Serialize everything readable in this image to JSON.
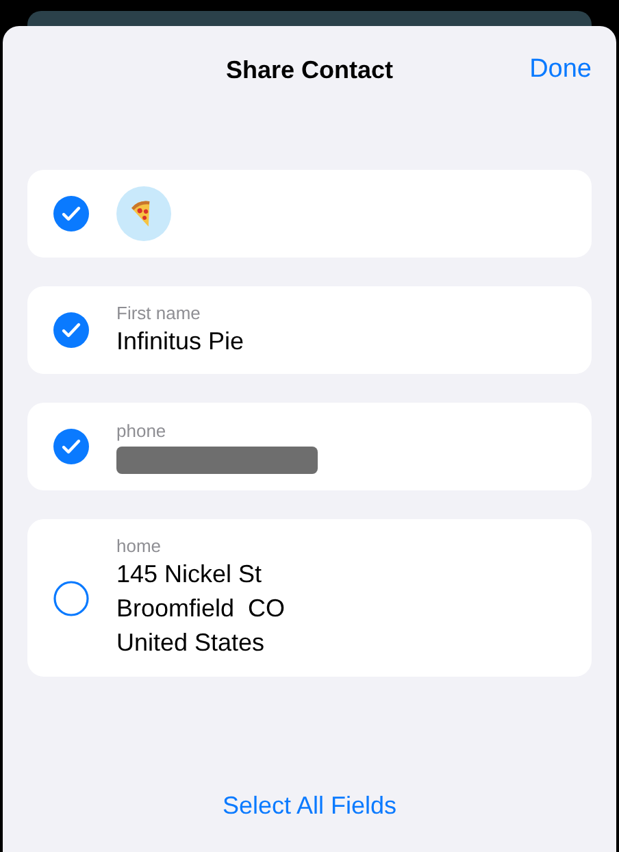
{
  "sheet": {
    "title": "Share Contact",
    "done_button": "Done"
  },
  "fields": [
    {
      "kind": "avatar",
      "checked": true
    },
    {
      "kind": "text",
      "checked": true,
      "label": "First name",
      "value": "Infinitus Pie"
    },
    {
      "kind": "redacted",
      "checked": true,
      "label": "phone"
    },
    {
      "kind": "address",
      "checked": false,
      "label": "home",
      "lines": [
        "145 Nickel St",
        "Broomfield  CO",
        "United States"
      ]
    }
  ],
  "select_all_button": "Select All Fields"
}
